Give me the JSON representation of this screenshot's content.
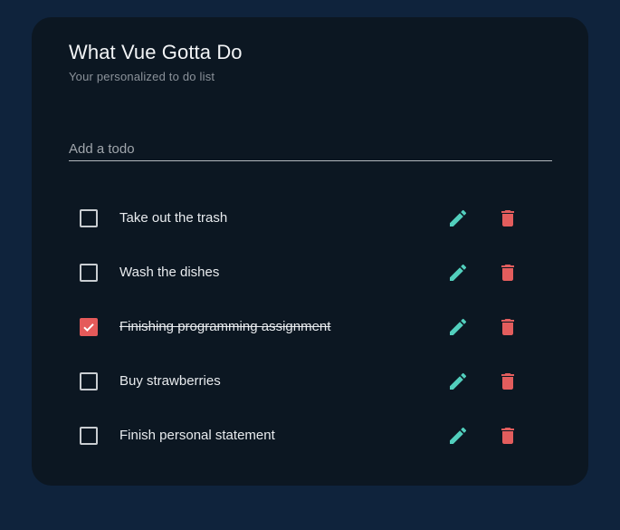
{
  "app": {
    "title": "What Vue Gotta Do",
    "subtitle": "Your personalized to do list"
  },
  "input": {
    "placeholder": "Add a todo",
    "value": ""
  },
  "colors": {
    "page_background": "#0f233c",
    "card_background": "#0c1722",
    "edit_icon": "#52cfbd",
    "delete_icon": "#e35d5d",
    "checked_box": "#e55a5a"
  },
  "icons": {
    "edit": "pencil-icon",
    "delete": "trash-icon",
    "checked": "checkmark-icon"
  },
  "todos": [
    {
      "text": "Take out the trash",
      "done": false
    },
    {
      "text": "Wash the dishes",
      "done": false
    },
    {
      "text": "Finishing programming assignment",
      "done": true
    },
    {
      "text": "Buy strawberries",
      "done": false
    },
    {
      "text": "Finish personal statement",
      "done": false
    }
  ]
}
